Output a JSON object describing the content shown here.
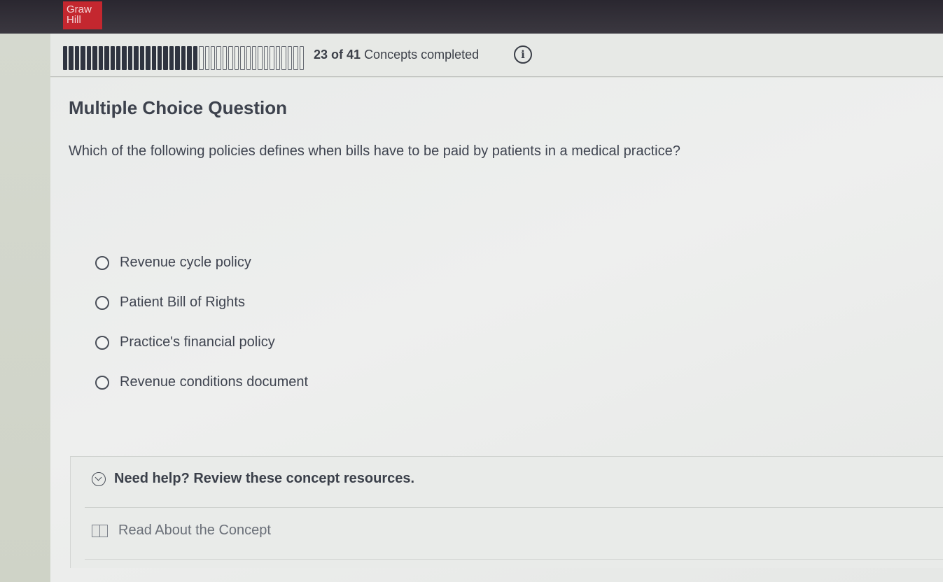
{
  "header": {
    "logo_line1": "Graw",
    "logo_line2": "Hill"
  },
  "progress": {
    "completed": 23,
    "total": 41,
    "count_text": "23 of 41",
    "label": "Concepts completed",
    "info_icon": "info-icon"
  },
  "question": {
    "type_label": "Multiple Choice Question",
    "text": "Which of the following policies defines when bills have to be paid by patients in a medical practice?",
    "options": [
      {
        "label": "Revenue cycle policy",
        "selected": false
      },
      {
        "label": "Patient Bill of Rights",
        "selected": false
      },
      {
        "label": "Practice's financial policy",
        "selected": false
      },
      {
        "label": "Revenue conditions document",
        "selected": false
      }
    ]
  },
  "help": {
    "toggle_label": "Need help? Review these concept resources.",
    "toggle_icon": "chevron-down-icon",
    "resource_label": "Read About the Concept",
    "resource_icon": "book-icon"
  },
  "colors": {
    "brand": "#c4272f",
    "topbar": "#2a2730",
    "progress_done": "#2f3440"
  }
}
